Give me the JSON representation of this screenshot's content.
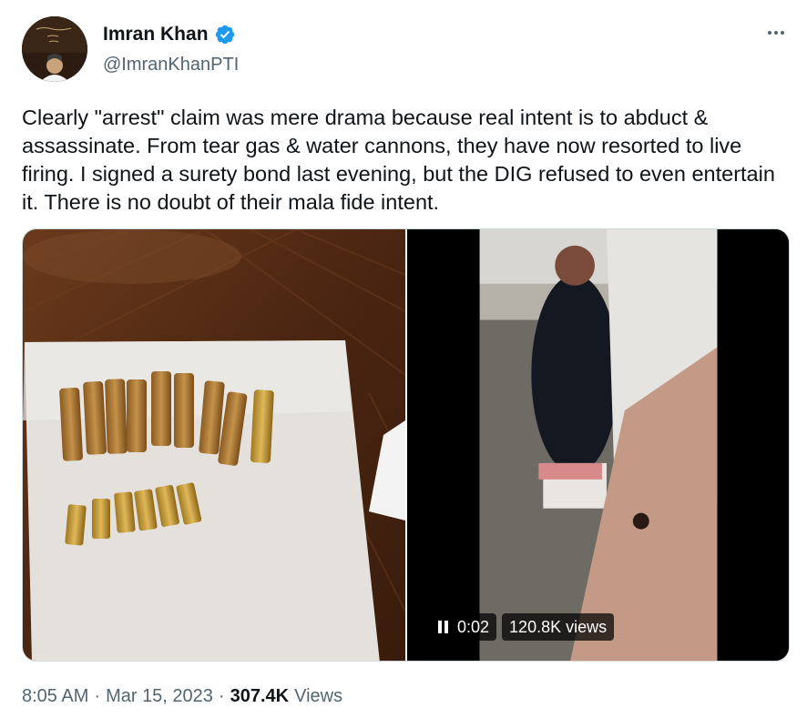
{
  "author": {
    "display_name": "Imran Khan",
    "handle": "@ImranKhanPTI",
    "avatar_icon": "profile-photo",
    "verified_icon": "verified-badge-icon",
    "verified_color": "#1d9bf0"
  },
  "more_icon": "more-options-icon",
  "tweet": {
    "text": "Clearly \"arrest\" claim was mere drama because real intent is to abduct & assassinate. From tear gas & water cannons, they have now resorted to live firing. I signed a surety bond last evening, but the DIG refused to even entertain it. There is no doubt of their mala fide intent."
  },
  "media": {
    "photo_icon": "photo-bullet-casings",
    "video": {
      "elapsed": "0:02",
      "views": "120.8K views",
      "pause_icon": "pause-icon"
    }
  },
  "meta": {
    "time": "8:05 AM",
    "separator": "·",
    "date": "Mar 15, 2023",
    "views_count": "307.4K",
    "views_label": "Views"
  }
}
